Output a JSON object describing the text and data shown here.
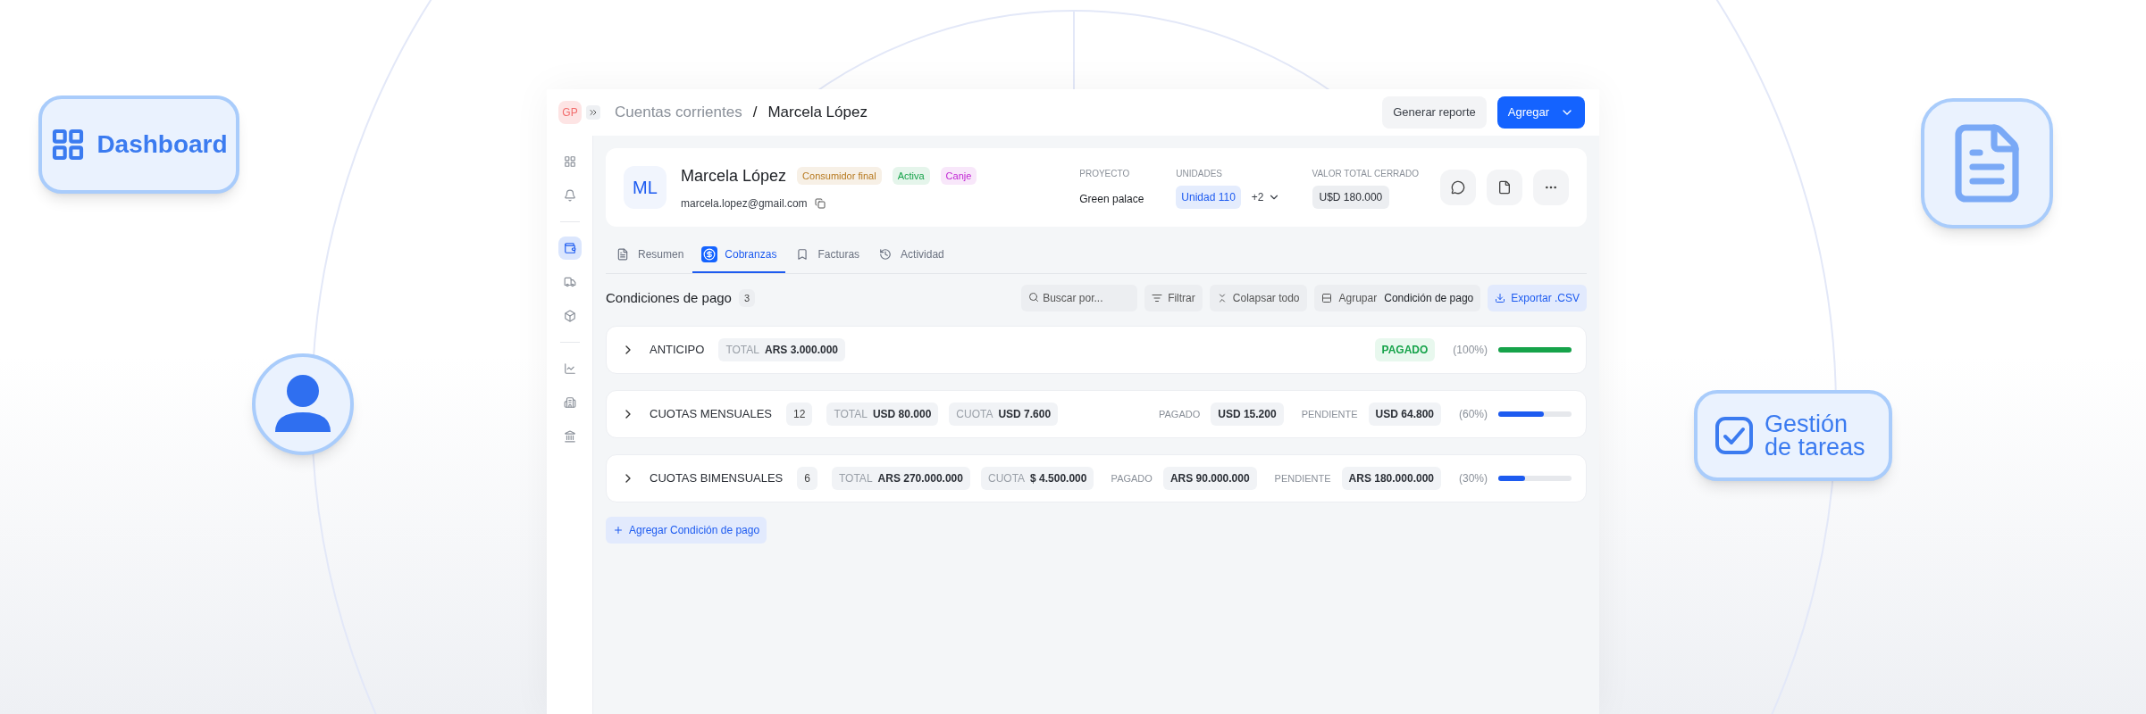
{
  "decorations": {
    "dashboard_badge": "Dashboard",
    "tasks_badge": "Gestión de tareas"
  },
  "header": {
    "workspace": "GP",
    "breadcrumb": [
      "Cuentas corrientes",
      "/",
      "Marcela López"
    ],
    "report_button": "Generar reporte",
    "add_button": "Agregar"
  },
  "sidebar": {
    "groups": [
      [
        {
          "selected": false
        },
        {
          "selected": false
        }
      ],
      [
        {
          "selected": true
        },
        {
          "selected": false
        },
        {
          "selected": false
        }
      ],
      [
        {
          "selected": false
        },
        {
          "selected": false
        },
        {
          "selected": false
        }
      ]
    ]
  },
  "profile": {
    "initials": "ML",
    "name": "Marcela López",
    "email": "marcela.lopez@gmail.com",
    "tags": [
      {
        "label": "Consumidor final",
        "color": "#b7791f"
      },
      {
        "label": "Activa",
        "color": "#16a34a"
      },
      {
        "label": "Canje",
        "color": "#c026d3"
      }
    ],
    "project": {
      "label": "PROYECTO",
      "value": "Green palace"
    },
    "units": {
      "label": "UNIDADES",
      "value": "Unidad 110",
      "more": "+2"
    },
    "total": {
      "label": "VALOR TOTAL CERRADO",
      "value": "U$D 180.000"
    }
  },
  "tabs": [
    {
      "label": "Resumen",
      "selected": false
    },
    {
      "label": "Cobranzas",
      "selected": true
    },
    {
      "label": "Facturas",
      "selected": false
    },
    {
      "label": "Actividad",
      "selected": false
    }
  ],
  "section": {
    "title": "Condiciones de pago",
    "count": "3",
    "search": {
      "placeholder": "Buscar por..."
    },
    "filter_button": "Filtrar",
    "collapse_button": "Colapsar todo",
    "group": {
      "label": "Agrupar",
      "value": "Condición de pago"
    },
    "export_button": "Exportar .CSV"
  },
  "conditions": [
    {
      "kind": "paid",
      "name": "ANTICIPO",
      "chips": [
        {
          "label": "TOTAL",
          "value": "ARS 3.000.000"
        }
      ],
      "status": "PAGADO",
      "percent": "(100%)",
      "level": 1,
      "color": "#16a34a"
    },
    {
      "kind": "partial",
      "name": "CUOTAS MENSUALES",
      "count": "12",
      "chips": [
        {
          "label": "TOTAL",
          "value": "USD 80.000"
        },
        {
          "label": "CUOTA",
          "value": "USD 7.600"
        }
      ],
      "paid": {
        "label": "PAGADO",
        "value": "USD 15.200"
      },
      "pending": {
        "label": "PENDIENTE",
        "value": "USD 64.800"
      },
      "percent": "(60%)",
      "level": 0.62,
      "color": "#1d5bf0"
    },
    {
      "kind": "partial",
      "name": "CUOTAS BIMENSUALES",
      "count": "6",
      "chips": [
        {
          "label": "TOTAL",
          "value": "ARS 270.000.000"
        },
        {
          "label": "CUOTA",
          "value": "$ 4.500.000"
        }
      ],
      "paid": {
        "label": "PAGADO",
        "value": "ARS 90.000.000"
      },
      "pending": {
        "label": "PENDIENTE",
        "value": "ARS 180.000.000"
      },
      "percent": "(30%)",
      "level": 0.37,
      "color": "#1d5bf0"
    }
  ],
  "add_condition_button": "Agregar Condición de pago"
}
